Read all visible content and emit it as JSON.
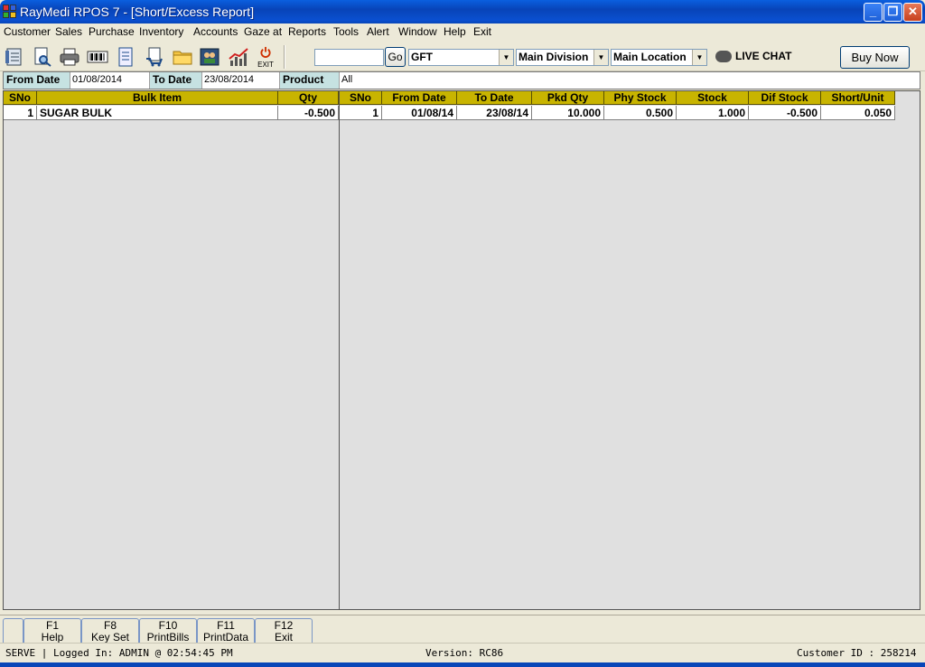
{
  "window": {
    "title": "RayMedi RPOS 7 - [Short/Excess Report]",
    "min_glyph": "_",
    "restore_glyph": "❐",
    "close_glyph": "✕"
  },
  "menu": [
    "Customer",
    "Sales",
    "Purchase",
    "Inventory",
    "Accounts",
    "Gaze at",
    "Reports",
    "Tools",
    "Alert",
    "Window",
    "Help",
    "Exit"
  ],
  "toolbar": {
    "exit_label": "EXIT",
    "search_value": "",
    "go_label": "Go",
    "store_combo": "GFT",
    "division_combo": "Main Division",
    "location_combo": "Main Location",
    "live_chat": "LIVE CHAT",
    "buy_now": "Buy Now"
  },
  "filters": {
    "from_date_label": "From Date",
    "from_date_value": "01/08/2014",
    "to_date_label": "To Date",
    "to_date_value": "23/08/2014",
    "product_label": "Product",
    "product_value": "All"
  },
  "left_grid": {
    "headers": [
      "SNo",
      "Bulk Item",
      "Qty"
    ],
    "rows": [
      {
        "sno": "1",
        "item": "SUGAR BULK",
        "qty": "-0.500"
      }
    ]
  },
  "right_grid": {
    "headers": [
      "SNo",
      "From Date",
      "To Date",
      "Pkd Qty",
      "Phy Stock",
      "Stock",
      "Dif Stock",
      "Short/Unit"
    ],
    "rows": [
      {
        "sno": "1",
        "from": "01/08/14",
        "to": "23/08/14",
        "pkd": "10.000",
        "phy": "0.500",
        "stock": "1.000",
        "dif": "-0.500",
        "short": "0.050"
      }
    ]
  },
  "fkeys": [
    {
      "key": "F1",
      "label": "Help"
    },
    {
      "key": "F8",
      "label": "Key Set"
    },
    {
      "key": "F10",
      "label": "PrintBills"
    },
    {
      "key": "F11",
      "label": "PrintData"
    },
    {
      "key": "F12",
      "label": "Exit"
    }
  ],
  "status": {
    "left": "SERVE |  Logged In: ADMIN  @ 02:54:45 PM",
    "version": "Version: RC86",
    "customer_id": "Customer ID : 258214"
  }
}
